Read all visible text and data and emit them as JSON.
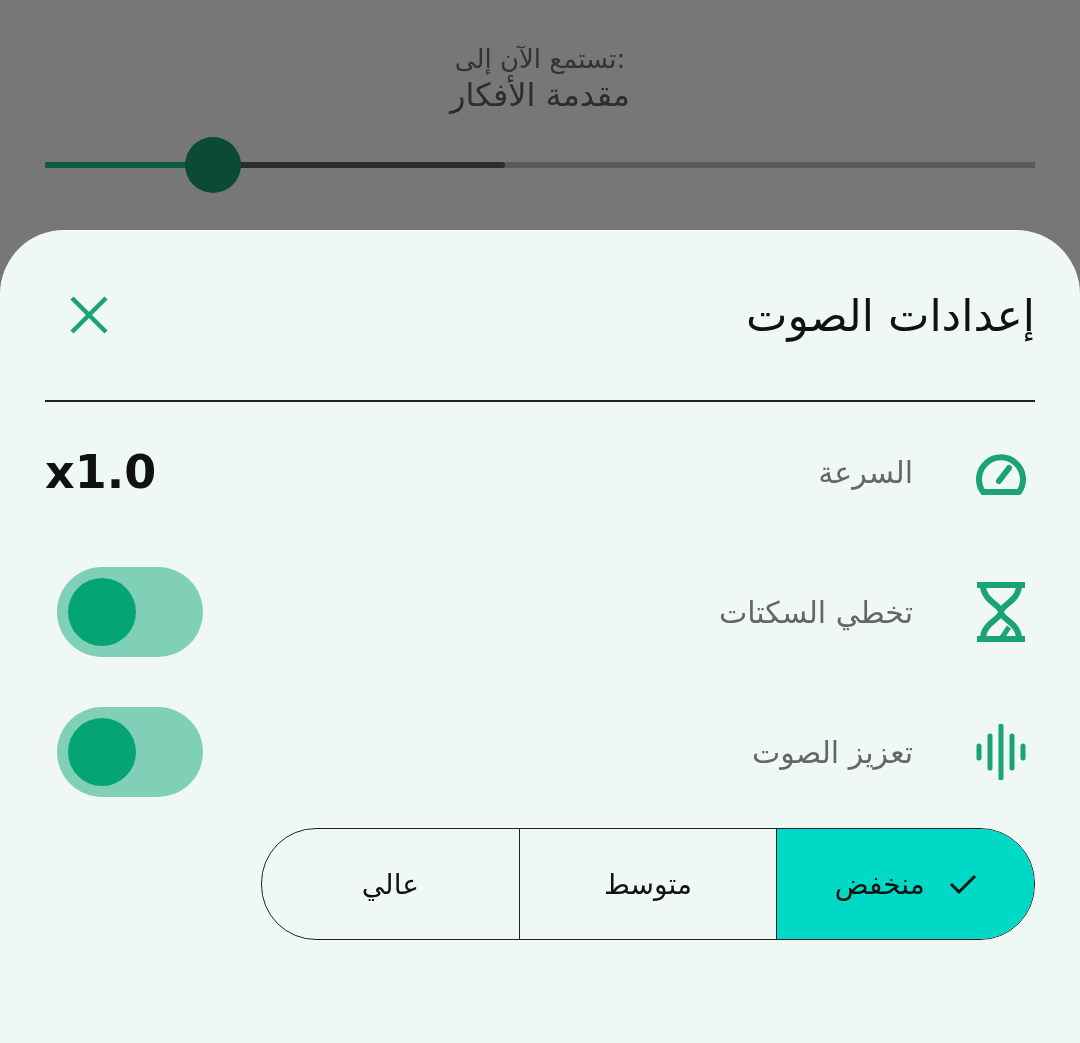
{
  "now_playing": {
    "label": "تستمع الآن إلى:",
    "title": "مقدمة الأفكار"
  },
  "progress": {
    "level": 0.17
  },
  "buffer": {
    "level": 0.465
  },
  "sheet": {
    "title": "إعدادات الصوت",
    "rows": [
      {
        "kind": "value",
        "label": "السرعة",
        "value": "x1.0"
      },
      {
        "kind": "toggle",
        "label": "تخطي السكتات",
        "on": true
      },
      {
        "kind": "toggle",
        "label": "تعزيز الصوت",
        "on": true
      }
    ],
    "levels": [
      {
        "label": "منخفض",
        "selected": true
      },
      {
        "label": "متوسط",
        "selected": false
      },
      {
        "label": "عالي",
        "selected": false
      }
    ]
  }
}
